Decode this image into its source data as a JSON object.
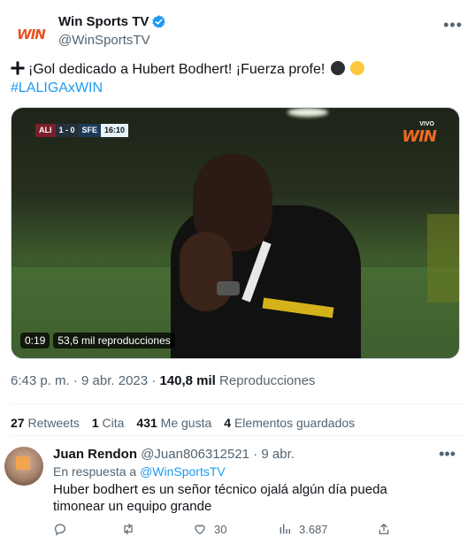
{
  "tweet": {
    "author_name": "Win Sports TV",
    "author_handle": "@WinSportsTV",
    "avatar_logo": "WIN",
    "text_main": "¡Gol dedicado a Hubert Bodhert! ¡Fuerza profe!",
    "hashtag": "#LALIGAxWIN",
    "icons": [
      "plus-icon",
      "black-circle-emoji",
      "yellow-circle-emoji",
      "verified-icon"
    ],
    "video": {
      "scoreboard": {
        "home": "ALI",
        "score": "1 - 0",
        "away": "SFE",
        "clock": "16:10"
      },
      "live_label": "VIVO",
      "channel_logo": "WIN",
      "duration": "0:19",
      "views_label": "53,6 mil reproducciones"
    },
    "meta": {
      "time": "6:43 p. m.",
      "separator": "·",
      "date": "9 abr. 2023",
      "views_count": "140,8 mil",
      "views_label": "Reproducciones"
    },
    "stats": {
      "retweets_count": "27",
      "retweets_label": "Retweets",
      "quotes_count": "1",
      "quotes_label": "Cita",
      "likes_count": "431",
      "likes_label": "Me gusta",
      "bookmarks_count": "4",
      "bookmarks_label": "Elementos guardados"
    }
  },
  "reply": {
    "name": "Juan Rendon",
    "handle": "@Juan806312521",
    "separator": "·",
    "date": "9 abr.",
    "reply_prefix": "En respuesta a",
    "reply_target": "@WinSportsTV",
    "text": "Huber  bodhert es un señor técnico ojalá algún día pueda timonear un equipo grande",
    "actions": {
      "likes": "30",
      "views": "3.687"
    }
  },
  "colors": {
    "accent": "#1d9bf0",
    "text_primary": "#0f1419",
    "text_secondary": "#536471",
    "divider": "#eff3f4"
  }
}
